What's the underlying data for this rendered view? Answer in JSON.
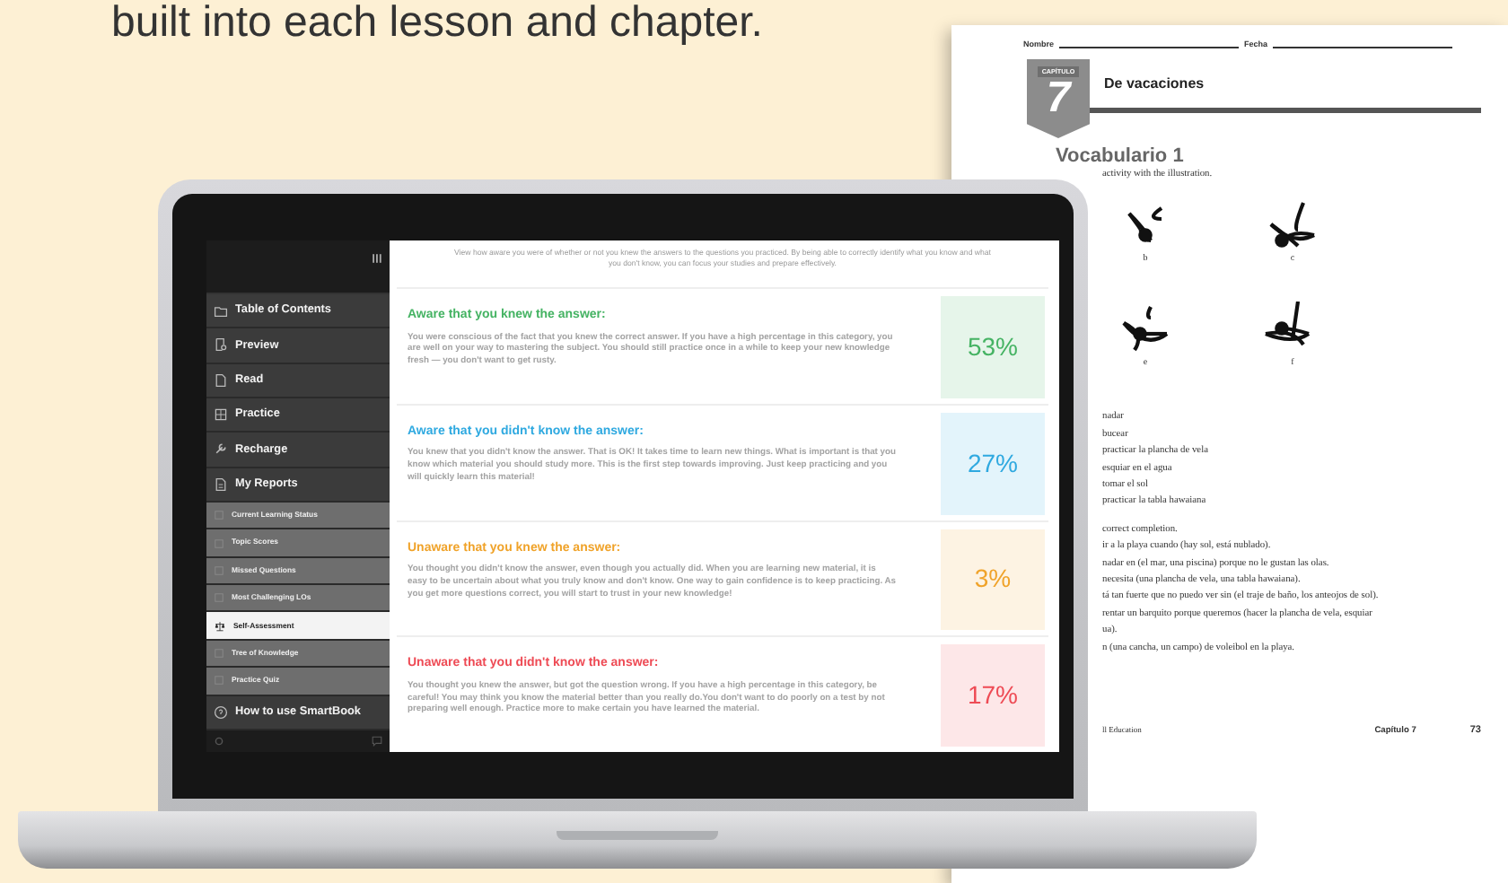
{
  "headline": "built into each lesson and chapter.",
  "app": {
    "sidebar": {
      "items": [
        {
          "label": "Table of Contents",
          "kind": "main",
          "selected": false
        },
        {
          "label": "Preview",
          "kind": "main",
          "selected": false
        },
        {
          "label": "Read",
          "kind": "main",
          "selected": false
        },
        {
          "label": "Practice",
          "kind": "main",
          "selected": false
        },
        {
          "label": "Recharge",
          "kind": "main",
          "selected": false
        },
        {
          "label": "My Reports",
          "kind": "main",
          "selected": false
        },
        {
          "label": "Current Learning Status",
          "kind": "sub",
          "selected": false
        },
        {
          "label": "Topic Scores",
          "kind": "sub",
          "selected": false
        },
        {
          "label": "Missed Questions",
          "kind": "sub",
          "selected": false
        },
        {
          "label": "Most Challenging LOs",
          "kind": "sub",
          "selected": false
        },
        {
          "label": "Self-Assessment",
          "kind": "sub",
          "selected": true
        },
        {
          "label": "Tree of Knowledge",
          "kind": "sub",
          "selected": false
        },
        {
          "label": "Practice Quiz",
          "kind": "sub",
          "selected": false
        },
        {
          "label": "How to use SmartBook",
          "kind": "main",
          "selected": false
        }
      ]
    },
    "intro": "View how aware you were of whether or not you knew the answers to the questions you practiced. By being able to correctly identify what you know and what you don't know, you can focus your studies and prepare effectively.",
    "categories": [
      {
        "title": "Aware that you knew the answer:",
        "text": "You were conscious of the fact that you knew the correct answer. If you have a high percentage in this category, you are well on your way to mastering the subject. You should still practice once in a while to keep your new knowledge fresh — you don't want to get rusty.",
        "percent": "53%",
        "color": "#45b363"
      },
      {
        "title": "Aware that you didn't know the answer:",
        "text": "You knew that you didn't know the answer. That is OK! It takes time to learn new things. What is important is that you know which material you should study more. This is the first step towards improving. Just keep practicing and you will quickly learn this material!",
        "percent": "27%",
        "color": "#2fa9e0"
      },
      {
        "title": "Unaware that you knew the answer:",
        "text": "You thought you didn't know the answer, even though you actually did. When you are learning new material, it is easy to be uncertain about what you truly know and don't know. One way to gain confidence is to keep practicing. As you get more questions correct, you will start to trust in your new knowledge!",
        "percent": "3%",
        "color": "#f0a32a"
      },
      {
        "title": "Unaware that you didn't know the answer:",
        "text": "You thought you knew the answer, but got the question wrong. If you have a high percentage in this category, be careful! You may think you know the material better than you really do.You don't want to do poorly on a test by not preparing well enough. Practice more to make certain you have learned the material.",
        "percent": "17%",
        "color": "#ee4b55"
      }
    ]
  },
  "worksheet": {
    "name_label": "Nombre",
    "date_label": "Fecha",
    "chapter_label": "CAPÍTULO",
    "chapter_number": "7",
    "chapter_title": "De vacaciones",
    "section_title": "Vocabulario 1",
    "instruction": "activity with the illustration.",
    "illustration_labels": [
      "b",
      "c",
      "e",
      "f"
    ],
    "word_list": [
      "nadar",
      "bucear",
      "practicar la plancha de vela",
      "esquiar en el agua",
      "tomar el sol",
      "practicar la tabla hawaiana"
    ],
    "completion_instruction": "correct completion.",
    "sentences": [
      "ir a la playa cuando (hay sol, está nublado).",
      "nadar en (el mar, una piscina) porque no le gustan las olas.",
      "necesita (una plancha de vela, una tabla hawaiana).",
      "tá tan fuerte que no puedo ver sin (el traje de baño, los anteojos de sol).",
      "rentar un barquito porque queremos (hacer la plancha de vela, esquiar",
      "ua).",
      "n (una cancha, un campo) de voleibol en la playa."
    ],
    "footer_left": "ll Education",
    "footer_chapter": "Capítulo 7",
    "page_number": "73"
  }
}
